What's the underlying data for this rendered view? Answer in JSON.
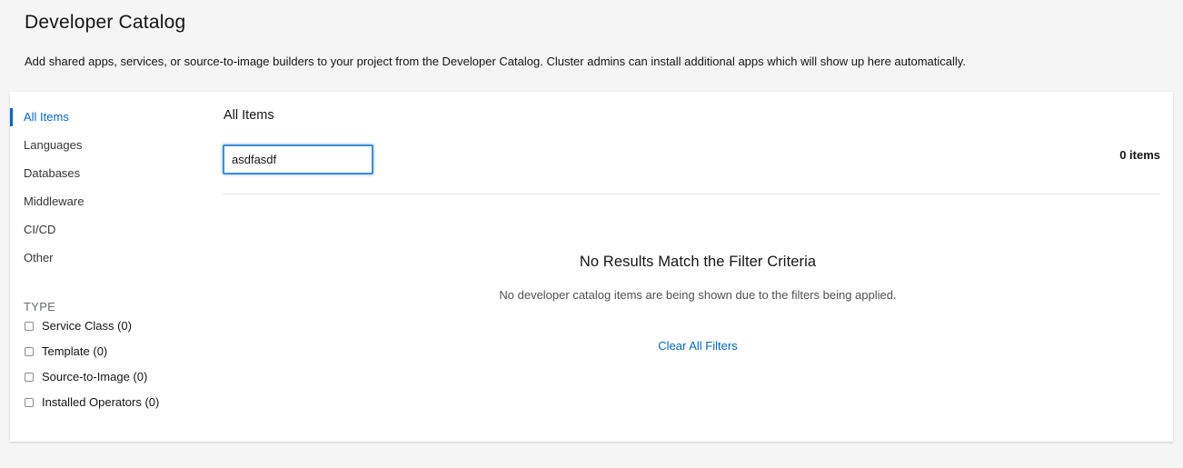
{
  "header": {
    "title": "Developer Catalog",
    "description": "Add shared apps, services, or source-to-image builders to your project from the Developer Catalog. Cluster admins can install additional apps which will show up here automatically."
  },
  "sidebar": {
    "categories": [
      {
        "label": "All Items",
        "active": true
      },
      {
        "label": "Languages",
        "active": false
      },
      {
        "label": "Databases",
        "active": false
      },
      {
        "label": "Middleware",
        "active": false
      },
      {
        "label": "CI/CD",
        "active": false
      },
      {
        "label": "Other",
        "active": false
      }
    ],
    "type_heading": "TYPE",
    "type_filters": [
      {
        "label": "Service Class (0)",
        "checked": false
      },
      {
        "label": "Template (0)",
        "checked": false
      },
      {
        "label": "Source-to-Image (0)",
        "checked": false
      },
      {
        "label": "Installed Operators (0)",
        "checked": false
      }
    ]
  },
  "main": {
    "section_title": "All Items",
    "search": {
      "value": "asdfasdf",
      "placeholder": ""
    },
    "item_count": "0 items",
    "empty_state": {
      "title": "No Results Match the Filter Criteria",
      "body": "No developer catalog items are being shown due to the filters being applied.",
      "clear_link": "Clear All Filters"
    }
  },
  "colors": {
    "accent": "#0066cc",
    "background": "#f5f5f5",
    "card": "#ffffff",
    "focus_border": "#3e8fd6"
  }
}
